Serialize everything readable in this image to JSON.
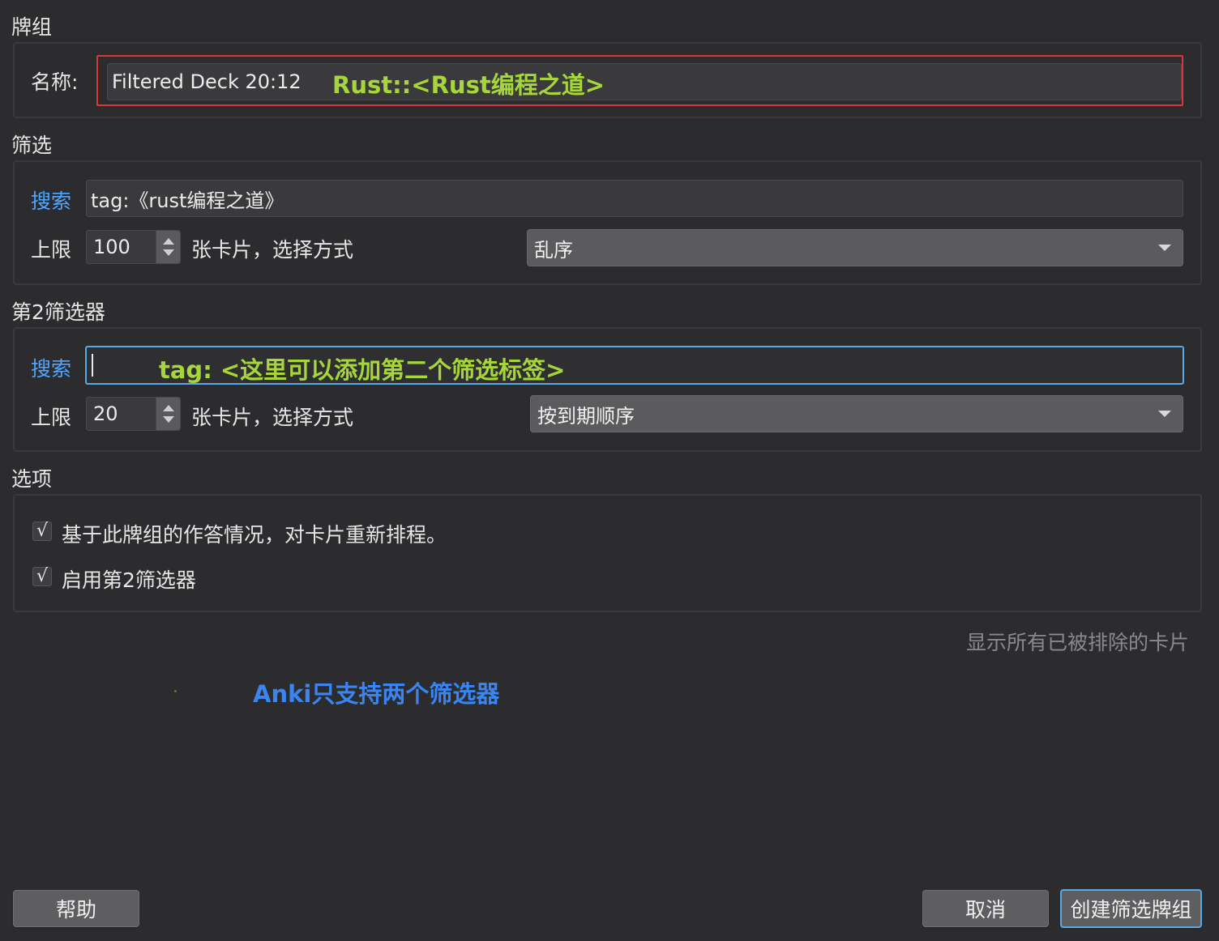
{
  "sections": {
    "deck": "牌组",
    "filter": "筛选",
    "filter2": "第2筛选器",
    "options": "选项"
  },
  "deck": {
    "name_label": "名称:",
    "name_value": "Filtered Deck 20:12",
    "annotation": "Rust::<Rust编程之道>"
  },
  "filter1": {
    "search_label": "搜索",
    "search_value": "tag:《rust编程之道》",
    "limit_label": "上限",
    "limit_value": "100",
    "suffix": "张卡片，选择方式",
    "order": "乱序"
  },
  "filter2": {
    "search_label": "搜索",
    "search_value": "",
    "annotation": "tag: <这里可以添加第二个筛选标签>",
    "limit_label": "上限",
    "limit_value": "20",
    "suffix": "张卡片，选择方式",
    "order": "按到期顺序"
  },
  "options": {
    "reschedule": {
      "label": "基于此牌组的作答情况，对卡片重新排程。",
      "checked": true
    },
    "enable_second": {
      "label": "启用第2筛选器",
      "checked": true
    },
    "check_glyph": "√"
  },
  "show_excluded": "显示所有已被排除的卡片",
  "annotation_bottom": "Anki只支持两个筛选器",
  "buttons": {
    "help": "帮助",
    "cancel": "取消",
    "create": "创建筛选牌组"
  },
  "colors": {
    "background": "#2c2c2e",
    "annotation_green": "#a6d63a",
    "annotation_blue": "#3a85f2",
    "highlight_red": "#d8383c",
    "focus_blue": "#5aa9e6"
  }
}
